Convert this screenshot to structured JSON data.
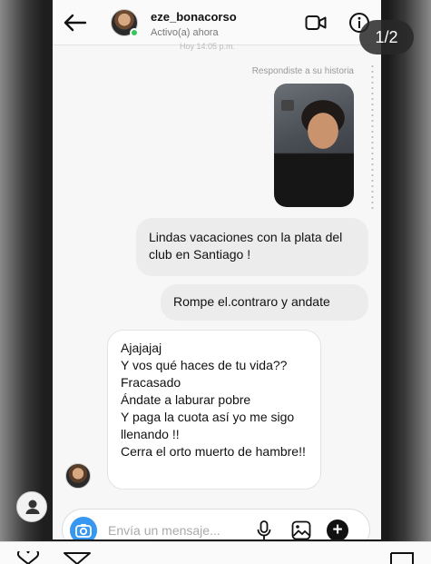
{
  "header": {
    "username": "eze_bonacorso",
    "status": "Activo(a) ahora",
    "faded_text": "Hoy 14:05 p.m.",
    "page_counter": "1/2"
  },
  "story_reply": {
    "note": "Respondiste a su historia"
  },
  "messages": [
    {
      "sender": "me",
      "text": "Lindas vacaciones con la plata del club en Santiago !"
    },
    {
      "sender": "me",
      "text": "Rompe el.contraro y andate"
    },
    {
      "sender": "them",
      "text": "Ajajajaj\nY vos qué haces de tu vida??\nFracasado\nÁndate a laburar pobre\nY paga la cuota así yo me sigo llenando  !!\nCerra el orto muerto de hambre!!"
    }
  ],
  "composer": {
    "placeholder": "Envía un mensaje..."
  },
  "colors": {
    "accent": "#3897f0",
    "online": "#35c759"
  },
  "icons": [
    "back-arrow-icon",
    "video-call-icon",
    "info-icon",
    "camera-icon",
    "microphone-icon",
    "gallery-icon",
    "plus-icon",
    "profile-icon",
    "heart-icon",
    "send-icon",
    "bookmark-icon"
  ]
}
